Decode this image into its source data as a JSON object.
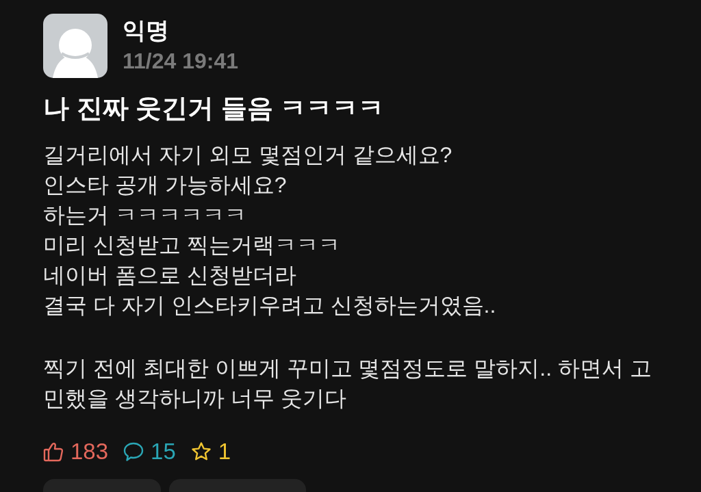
{
  "post": {
    "author": "익명",
    "time": "11/24 19:41",
    "title": "나 진짜 웃긴거 들음 ㅋㅋㅋㅋ",
    "paragraphs": [
      [
        "길거리에서 자기 외모 몇점인거 같으세요?",
        "인스타 공개 가능하세요?",
        "하는거 ㅋㅋㅋㅋㅋㅋ",
        "미리 신청받고 찍는거랙ㅋㅋㅋ",
        "네이버 폼으로 신청받더라",
        "결국 다 자기 인스타키우려고 신청하는거였음.."
      ],
      [
        "찍기 전에 최대한 이쁘게 꾸미고 몇점정도로 말하지.. 하면서 고민했을 생각하니까 너무 웃기다"
      ]
    ]
  },
  "stats": [
    {
      "kind": "like",
      "count": "183",
      "color": "#e4685c"
    },
    {
      "kind": "comment",
      "count": "15",
      "color": "#2aa6b5"
    },
    {
      "kind": "scrap",
      "count": "1",
      "color": "#f0c531"
    }
  ]
}
